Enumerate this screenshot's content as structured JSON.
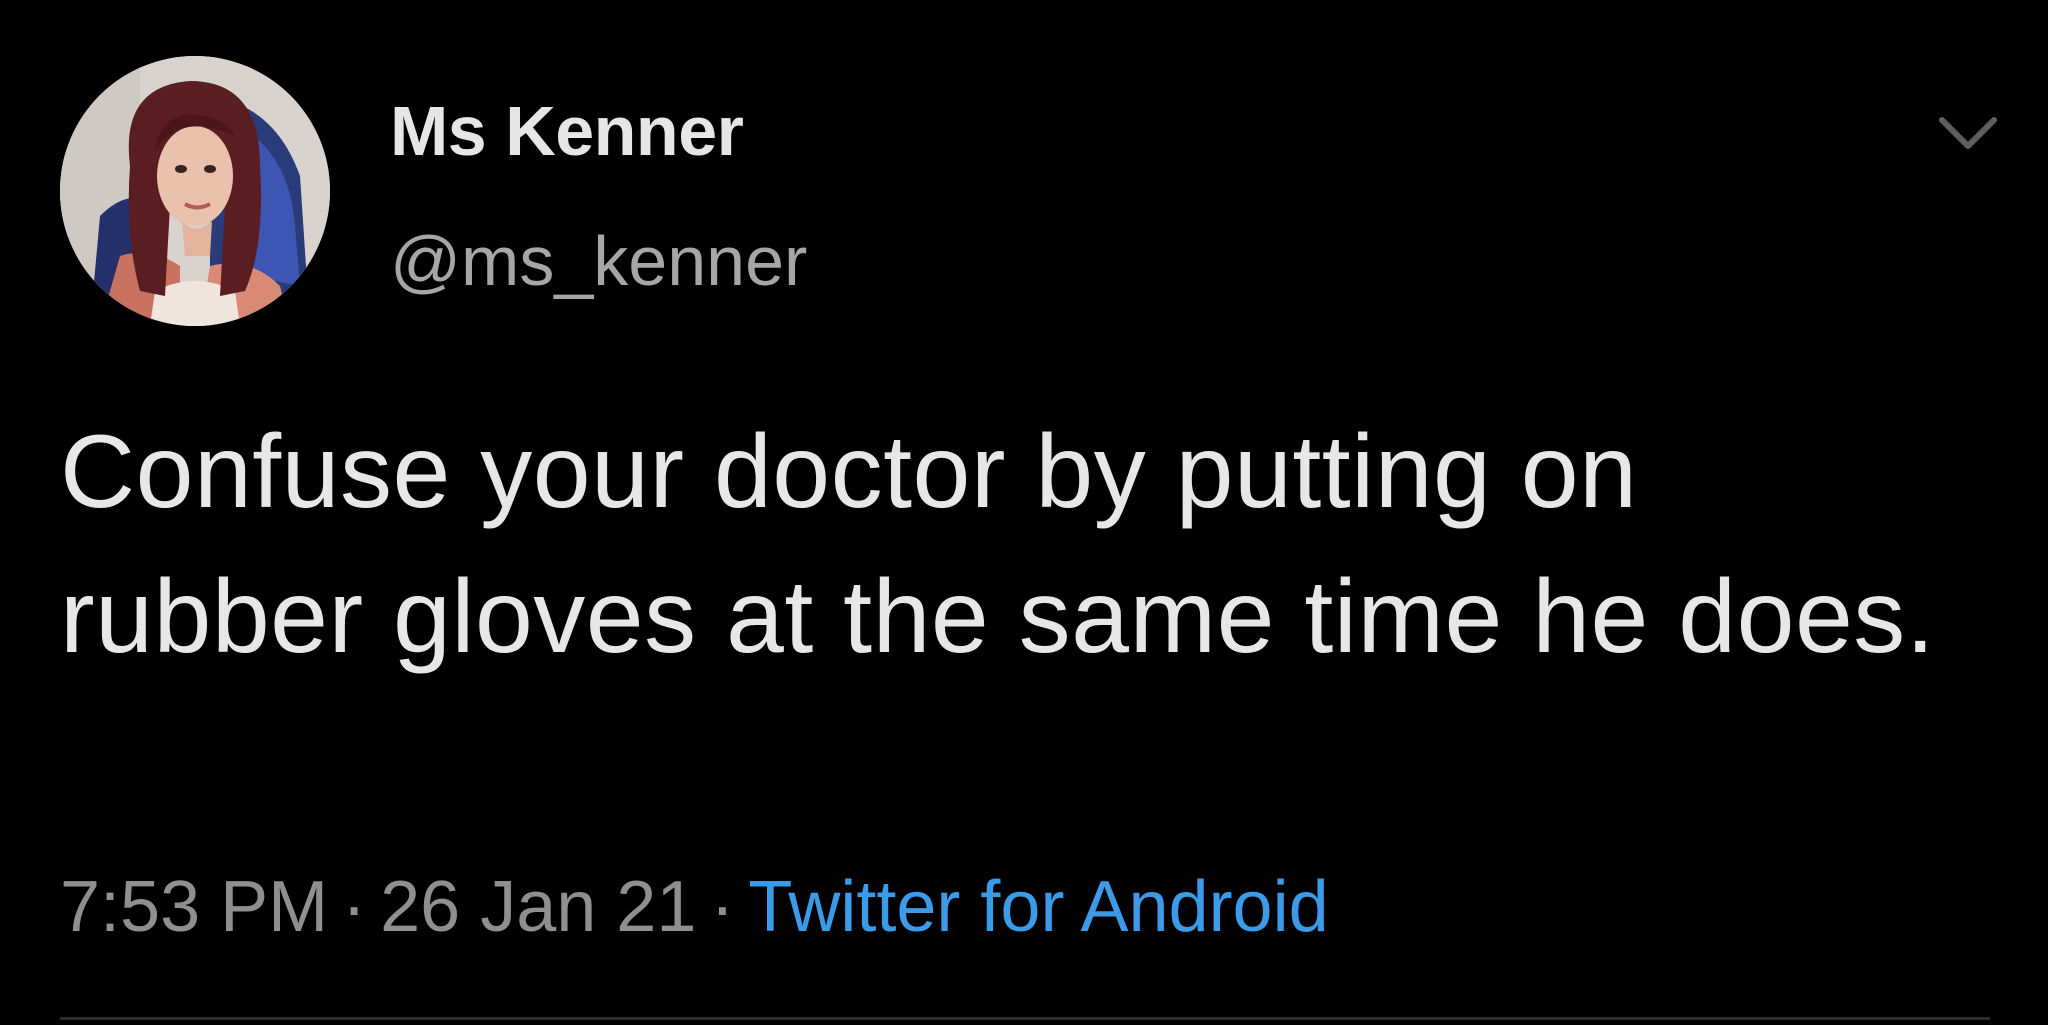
{
  "tweet": {
    "display_name": "Ms Kenner",
    "handle": "@ms_kenner",
    "text": "Confuse your doctor by putting on rubber gloves at the same time he does.",
    "time": "7:53 PM",
    "separator": "·",
    "date": "26 Jan 21",
    "source": "Twitter for Android"
  },
  "icons": {
    "avatar": "profile-photo",
    "more": "chevron-down-icon"
  },
  "colors": {
    "background": "#000000",
    "primary_text": "#e7e7e7",
    "secondary_text": "#8f8f8f",
    "link": "#3b9be8",
    "divider": "#2b2b2b"
  }
}
